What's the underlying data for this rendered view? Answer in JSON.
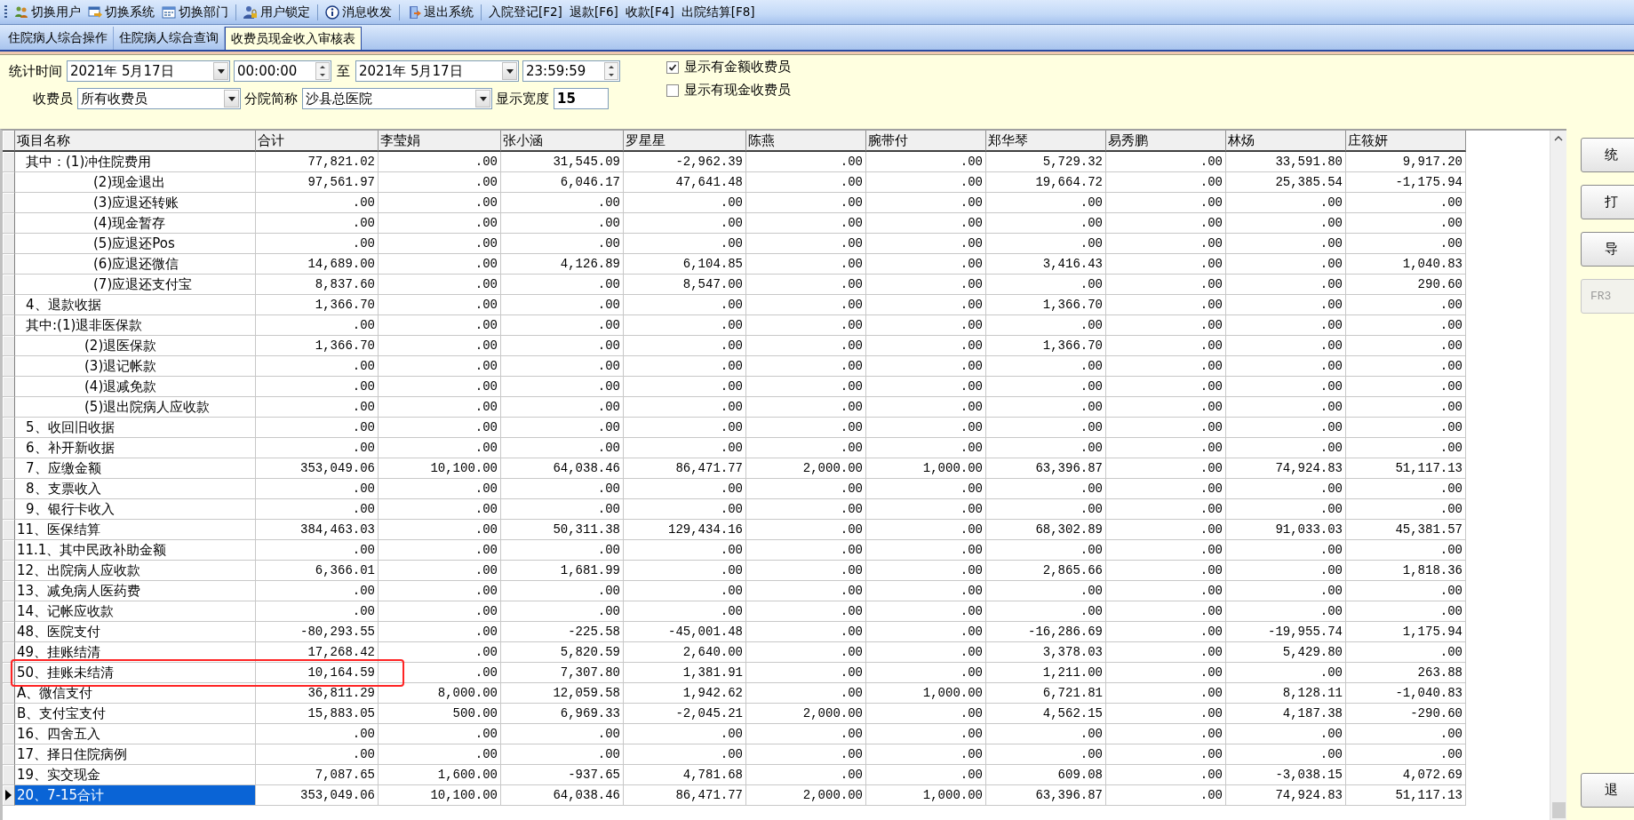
{
  "toolbar": [
    {
      "kind": "icon-button",
      "label": "切换用户"
    },
    {
      "kind": "icon-button",
      "label": "切换系统"
    },
    {
      "kind": "icon-button",
      "label": "切换部门"
    },
    {
      "kind": "separator"
    },
    {
      "kind": "icon-button",
      "label": "用户锁定"
    },
    {
      "kind": "separator"
    },
    {
      "kind": "icon-button",
      "label": "消息收发"
    },
    {
      "kind": "separator"
    },
    {
      "kind": "icon-button",
      "label": "退出系统"
    },
    {
      "kind": "separator"
    },
    {
      "kind": "text-button",
      "label": "入院登记[F2]"
    },
    {
      "kind": "text-button",
      "label": "退款[F6]"
    },
    {
      "kind": "text-button",
      "label": "收款[F4]"
    },
    {
      "kind": "text-button",
      "label": "出院结算[F8]"
    }
  ],
  "tabs": [
    {
      "label": "住院病人综合操作",
      "selected": false
    },
    {
      "label": "住院病人综合查询",
      "selected": false
    },
    {
      "label": "收费员现金收入审核表",
      "selected": true
    }
  ],
  "filters": {
    "period_label": "统计时间",
    "date_from": "2021年 5月17日",
    "time_from": "00:00:00",
    "to_label": "至",
    "date_to": "2021年 5月17日",
    "time_to": "23:59:59",
    "cashier_label": "收费员",
    "cashier": "所有收费员",
    "branch_label": "分院简称",
    "branch": "沙县总医院",
    "width_label": "显示宽度",
    "width_value": "15",
    "checkboxes": [
      {
        "label": "显示有金额收费员",
        "checked": true
      },
      {
        "label": "显示有现金收费员",
        "checked": false
      }
    ]
  },
  "table": {
    "columns": [
      "项目名称",
      "合计",
      "李莹娟",
      "张小涵",
      "罗星星",
      "陈燕",
      "腕带付",
      "郑华琴",
      "易秀鹏",
      "林炀",
      "庄筱妍"
    ],
    "rows": [
      {
        "kind": "group",
        "selected": false,
        "label": "其中：(1)冲住院费用",
        "values": [
          "77,821.02",
          ".00",
          "31,545.09",
          "-2,962.39",
          ".00",
          ".00",
          "5,729.32",
          ".00",
          "33,591.80",
          "9,917.20"
        ]
      },
      {
        "kind": "sub",
        "selected": false,
        "label": "(2)现金退出",
        "values": [
          "97,561.97",
          ".00",
          "6,046.17",
          "47,641.48",
          ".00",
          ".00",
          "19,664.72",
          ".00",
          "25,385.54",
          "-1,175.94"
        ]
      },
      {
        "kind": "sub",
        "selected": false,
        "label": "(3)应退还转账",
        "values": [
          ".00",
          ".00",
          ".00",
          ".00",
          ".00",
          ".00",
          ".00",
          ".00",
          ".00",
          ".00"
        ]
      },
      {
        "kind": "sub",
        "selected": false,
        "label": "(4)现金暂存",
        "values": [
          ".00",
          ".00",
          ".00",
          ".00",
          ".00",
          ".00",
          ".00",
          ".00",
          ".00",
          ".00"
        ]
      },
      {
        "kind": "sub",
        "selected": false,
        "label": "(5)应退还Pos",
        "values": [
          ".00",
          ".00",
          ".00",
          ".00",
          ".00",
          ".00",
          ".00",
          ".00",
          ".00",
          ".00"
        ]
      },
      {
        "kind": "sub",
        "selected": false,
        "label": "(6)应退还微信",
        "values": [
          "14,689.00",
          ".00",
          "4,126.89",
          "6,104.85",
          ".00",
          ".00",
          "3,416.43",
          ".00",
          ".00",
          "1,040.83"
        ]
      },
      {
        "kind": "sub",
        "selected": false,
        "label": "(7)应退还支付宝",
        "values": [
          "8,837.60",
          ".00",
          ".00",
          "8,547.00",
          ".00",
          ".00",
          ".00",
          ".00",
          ".00",
          "290.60"
        ]
      },
      {
        "kind": "group",
        "selected": false,
        "label": "4、退款收据",
        "values": [
          "1,366.70",
          ".00",
          ".00",
          ".00",
          ".00",
          ".00",
          "1,366.70",
          ".00",
          ".00",
          ".00"
        ]
      },
      {
        "kind": "group",
        "selected": false,
        "label": "其中:(1)退非医保款",
        "values": [
          ".00",
          ".00",
          ".00",
          ".00",
          ".00",
          ".00",
          ".00",
          ".00",
          ".00",
          ".00"
        ]
      },
      {
        "kind": "sub2",
        "selected": false,
        "label": "(2)退医保款",
        "values": [
          "1,366.70",
          ".00",
          ".00",
          ".00",
          ".00",
          ".00",
          "1,366.70",
          ".00",
          ".00",
          ".00"
        ]
      },
      {
        "kind": "sub2",
        "selected": false,
        "label": "(3)退记帐款",
        "values": [
          ".00",
          ".00",
          ".00",
          ".00",
          ".00",
          ".00",
          ".00",
          ".00",
          ".00",
          ".00"
        ]
      },
      {
        "kind": "sub2",
        "selected": false,
        "label": "(4)退减免款",
        "values": [
          ".00",
          ".00",
          ".00",
          ".00",
          ".00",
          ".00",
          ".00",
          ".00",
          ".00",
          ".00"
        ]
      },
      {
        "kind": "sub2",
        "selected": false,
        "label": "(5)退出院病人应收款",
        "values": [
          ".00",
          ".00",
          ".00",
          ".00",
          ".00",
          ".00",
          ".00",
          ".00",
          ".00",
          ".00"
        ]
      },
      {
        "kind": "group",
        "selected": false,
        "label": "5、收回旧收据",
        "values": [
          ".00",
          ".00",
          ".00",
          ".00",
          ".00",
          ".00",
          ".00",
          ".00",
          ".00",
          ".00"
        ]
      },
      {
        "kind": "group",
        "selected": false,
        "label": "6、补开新收据",
        "values": [
          ".00",
          ".00",
          ".00",
          ".00",
          ".00",
          ".00",
          ".00",
          ".00",
          ".00",
          ".00"
        ]
      },
      {
        "kind": "group",
        "selected": false,
        "label": "7、应缴金额",
        "values": [
          "353,049.06",
          "10,100.00",
          "64,038.46",
          "86,471.77",
          "2,000.00",
          "1,000.00",
          "63,396.87",
          ".00",
          "74,924.83",
          "51,117.13"
        ]
      },
      {
        "kind": "group",
        "selected": false,
        "label": "8、支票收入",
        "values": [
          ".00",
          ".00",
          ".00",
          ".00",
          ".00",
          ".00",
          ".00",
          ".00",
          ".00",
          ".00"
        ]
      },
      {
        "kind": "group",
        "selected": false,
        "label": "9、银行卡收入",
        "values": [
          ".00",
          ".00",
          ".00",
          ".00",
          ".00",
          ".00",
          ".00",
          ".00",
          ".00",
          ".00"
        ]
      },
      {
        "kind": "top",
        "selected": false,
        "label": "11、医保结算",
        "values": [
          "384,463.03",
          ".00",
          "50,311.38",
          "129,434.16",
          ".00",
          ".00",
          "68,302.89",
          ".00",
          "91,033.03",
          "45,381.57"
        ]
      },
      {
        "kind": "top",
        "selected": false,
        "label": "11.1、其中民政补助金额",
        "values": [
          ".00",
          ".00",
          ".00",
          ".00",
          ".00",
          ".00",
          ".00",
          ".00",
          ".00",
          ".00"
        ]
      },
      {
        "kind": "top",
        "selected": false,
        "label": "12、出院病人应收款",
        "values": [
          "6,366.01",
          ".00",
          "1,681.99",
          ".00",
          ".00",
          ".00",
          "2,865.66",
          ".00",
          ".00",
          "1,818.36"
        ]
      },
      {
        "kind": "top",
        "selected": false,
        "label": "13、减免病人医药费",
        "values": [
          ".00",
          ".00",
          ".00",
          ".00",
          ".00",
          ".00",
          ".00",
          ".00",
          ".00",
          ".00"
        ]
      },
      {
        "kind": "top",
        "selected": false,
        "label": "14、记帐应收款",
        "values": [
          ".00",
          ".00",
          ".00",
          ".00",
          ".00",
          ".00",
          ".00",
          ".00",
          ".00",
          ".00"
        ]
      },
      {
        "kind": "top",
        "selected": false,
        "label": "48、医院支付",
        "values": [
          "-80,293.55",
          ".00",
          "-225.58",
          "-45,001.48",
          ".00",
          ".00",
          "-16,286.69",
          ".00",
          "-19,955.74",
          "1,175.94"
        ]
      },
      {
        "kind": "top",
        "selected": false,
        "label": "49、挂账结清",
        "values": [
          "17,268.42",
          ".00",
          "5,820.59",
          "2,640.00",
          ".00",
          ".00",
          "3,378.03",
          ".00",
          "5,429.80",
          ".00"
        ]
      },
      {
        "kind": "top",
        "selected": false,
        "label": "50、挂账未结清",
        "values": [
          "10,164.59",
          ".00",
          "7,307.80",
          "1,381.91",
          ".00",
          ".00",
          "1,211.00",
          ".00",
          ".00",
          "263.88"
        ]
      },
      {
        "kind": "top",
        "selected": false,
        "label": "A、微信支付",
        "values": [
          "36,811.29",
          "8,000.00",
          "12,059.58",
          "1,942.62",
          ".00",
          "1,000.00",
          "6,721.81",
          ".00",
          "8,128.11",
          "-1,040.83"
        ]
      },
      {
        "kind": "top",
        "selected": false,
        "label": "B、支付宝支付",
        "values": [
          "15,883.05",
          "500.00",
          "6,969.33",
          "-2,045.21",
          "2,000.00",
          ".00",
          "4,562.15",
          ".00",
          "4,187.38",
          "-290.60"
        ]
      },
      {
        "kind": "top",
        "selected": false,
        "label": "16、四舍五入",
        "values": [
          ".00",
          ".00",
          ".00",
          ".00",
          ".00",
          ".00",
          ".00",
          ".00",
          ".00",
          ".00"
        ]
      },
      {
        "kind": "top",
        "selected": false,
        "label": "17、择日住院病例",
        "values": [
          ".00",
          ".00",
          ".00",
          ".00",
          ".00",
          ".00",
          ".00",
          ".00",
          ".00",
          ".00"
        ]
      },
      {
        "kind": "top",
        "selected": false,
        "label": "19、实交现金",
        "values": [
          "7,087.65",
          "1,600.00",
          "-937.65",
          "4,781.68",
          ".00",
          ".00",
          "609.08",
          ".00",
          "-3,038.15",
          "4,072.69"
        ]
      },
      {
        "kind": "top",
        "selected": true,
        "label": "20、7-15合计",
        "values": [
          "353,049.06",
          "10,100.00",
          "64,038.46",
          "86,471.77",
          "2,000.00",
          "1,000.00",
          "63,396.87",
          ".00",
          "74,924.83",
          "51,117.13"
        ]
      }
    ]
  },
  "side_buttons": [
    {
      "label": "统",
      "disabled": false
    },
    {
      "label": "打",
      "disabled": false
    },
    {
      "label": "导",
      "disabled": false
    },
    {
      "label": "FR3",
      "disabled": true
    }
  ],
  "exit_button": {
    "label": "退",
    "disabled": false
  }
}
